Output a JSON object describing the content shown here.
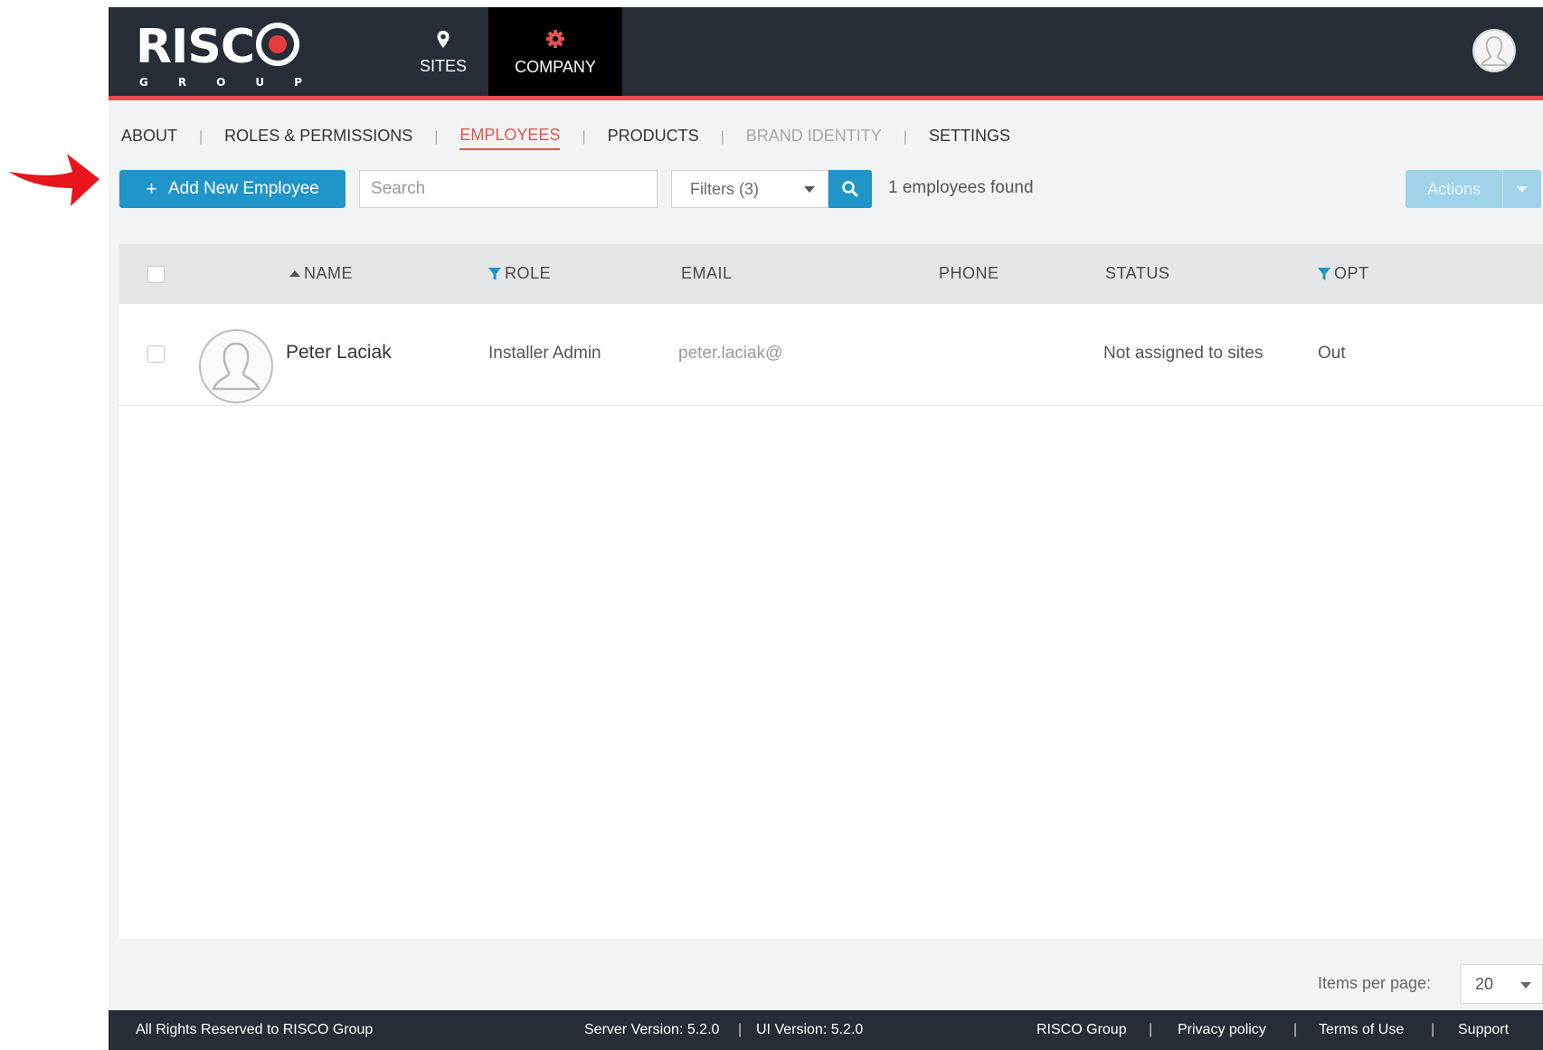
{
  "caption": {
    "left_fragment": "",
    "right_fragment": ""
  },
  "header": {
    "logo_text": "RISC",
    "logo_sub": [
      "G",
      "R",
      "O",
      "U",
      "P"
    ],
    "nav": {
      "sites": "SITES",
      "company": "COMPANY"
    }
  },
  "subnav": {
    "about": "ABOUT",
    "roles": "ROLES & PERMISSIONS",
    "employees": "EMPLOYEES",
    "products": "PRODUCTS",
    "brand_identity": "BRAND IDENTITY",
    "settings": "SETTINGS",
    "separator": "|"
  },
  "toolbar": {
    "add_label": "Add New Employee",
    "add_icon": "+",
    "search_placeholder": "Search",
    "filters_label": "Filters (3)",
    "found_text": "1 employees found",
    "actions_label": "Actions"
  },
  "table": {
    "columns": {
      "name": "NAME",
      "role": "ROLE",
      "email": "EMAIL",
      "phone": "PHONE",
      "status": "STATUS",
      "opt": "OPT"
    },
    "rows": [
      {
        "name": "Peter Laciak",
        "role": "Installer Admin",
        "email": "peter.laciak@",
        "phone": "",
        "status": "Not assigned to sites",
        "opt": "Out"
      }
    ]
  },
  "pagination": {
    "items_per_page_label": "Items per page:",
    "items_per_page_value": "20"
  },
  "footer": {
    "rights": "All Rights Reserved to RISCO Group",
    "server_version": "Server Version: 5.2.0",
    "ui_version": "UI Version: 5.2.0",
    "separator": "|",
    "links": [
      "RISCO Group",
      "Privacy policy",
      "Terms of Use",
      "Support"
    ]
  },
  "colors": {
    "header_bg": "#262d37",
    "accent_red": "#e5534b",
    "primary_blue": "#1f95c9",
    "actions_disabled": "#9fd3e9",
    "annotation_arrow": "#e8161c"
  },
  "icons": {
    "sites": "map-pin-icon",
    "company": "gear-icon",
    "search": "search-icon",
    "filter": "funnel-icon",
    "sort": "sort-up-icon",
    "avatar": "user-avatar-icon",
    "annotation": "red-arrow-icon"
  }
}
